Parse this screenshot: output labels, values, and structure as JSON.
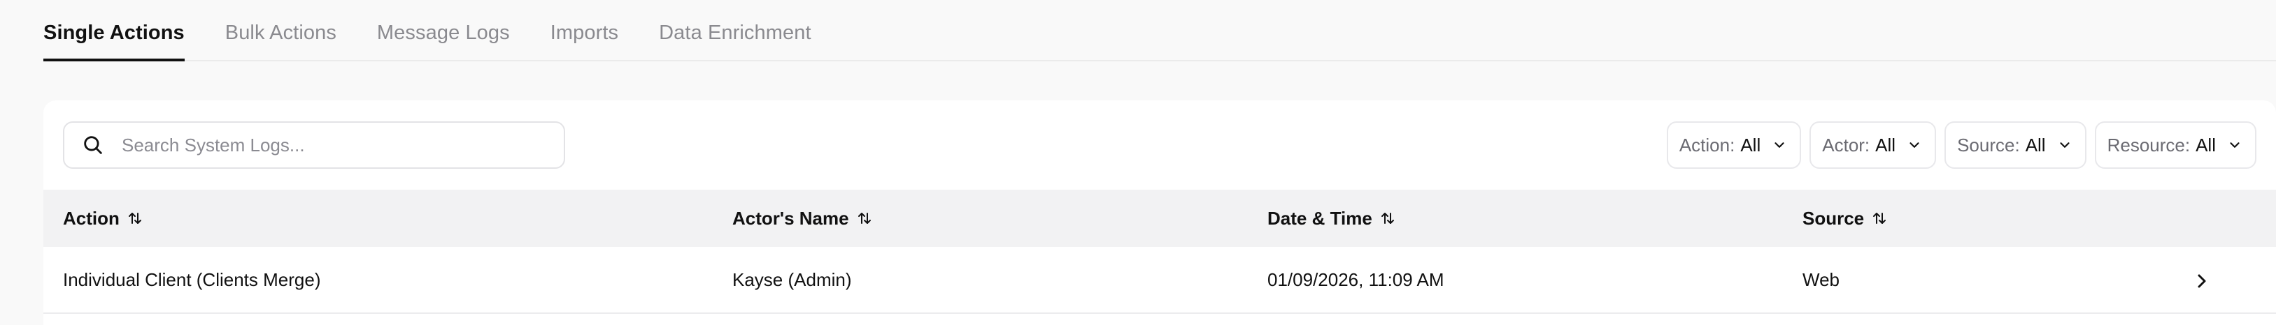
{
  "tabs": [
    {
      "label": "Single Actions",
      "active": true
    },
    {
      "label": "Bulk Actions"
    },
    {
      "label": "Message Logs"
    },
    {
      "label": "Imports"
    },
    {
      "label": "Data Enrichment"
    }
  ],
  "search": {
    "placeholder": "Search System Logs...",
    "value": "",
    "icon": "search-icon"
  },
  "filters": [
    {
      "label": "Action:",
      "value": "All"
    },
    {
      "label": "Actor:",
      "value": "All"
    },
    {
      "label": "Source:",
      "value": "All"
    },
    {
      "label": "Resource:",
      "value": "All"
    }
  ],
  "table": {
    "columns": [
      "Action",
      "Actor's Name",
      "Date & Time",
      "Source"
    ],
    "rows": [
      {
        "action": "Individual Client (Clients Merge)",
        "actor": "Kayse (Admin)",
        "datetime": "01/09/2026, 11:09 AM",
        "source": "Web"
      }
    ]
  },
  "icons": {
    "sort": "sort-arrows-icon",
    "row_open": "chevron-right-icon",
    "filter_open": "chevron-down-icon"
  },
  "colors": {
    "background": "#f9f9f9",
    "header_bg": "#f2f2f3",
    "active_tab": "#111111",
    "inactive_tab": "#8a8a8f"
  }
}
